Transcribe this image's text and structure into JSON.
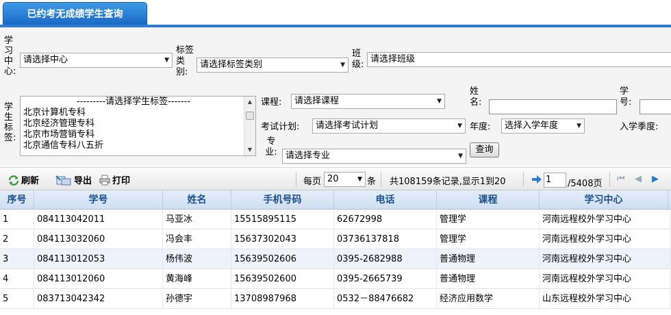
{
  "tab": {
    "title": "已约考无成绩学生查询"
  },
  "filters": {
    "center_label": "学习中心:",
    "center_value": "请选择中心",
    "tag_type_label": "标签类别:",
    "tag_type_value": "请选择标签类别",
    "class_label": "班级:",
    "class_value": "请选择班级",
    "student_tag_label": "学生标签:",
    "student_tag_options": [
      "---------请选择学生标签-------",
      "北京计算机专科",
      "北京经济管理专科",
      "北京市场营销专科",
      "北京通信专科八五折"
    ],
    "course_label": "课程:",
    "course_value": "请选择课程",
    "name_label": "姓名:",
    "student_no_label": "学号:",
    "exam_plan_label": "考试计划:",
    "exam_plan_value": "请选择考试计划",
    "year_label": "年度:",
    "year_value": "选择入学年度",
    "season_label": "入学季度:",
    "major_label": "专业:",
    "major_value": "请选择专业",
    "query_button": "查询"
  },
  "toolbar": {
    "refresh": "刷新",
    "export": "导出",
    "print": "打印",
    "per_page_label": "每页",
    "per_page_value": "20",
    "per_page_unit": "条",
    "summary": "共108159条记录,显示1到20",
    "page_input": "1",
    "page_total": "/5408页"
  },
  "table": {
    "columns": [
      "序号",
      "学号",
      "姓名",
      "手机号码",
      "电话",
      "课程",
      "学习中心"
    ],
    "rows": [
      [
        "1",
        "084113042011",
        "马亚冰",
        "15515895115",
        "62672998",
        "管理学",
        "河南远程校外学习中心"
      ],
      [
        "2",
        "084113032060",
        "冯会丰",
        "15637302043",
        "03736137818",
        "管理学",
        "河南远程校外学习中心"
      ],
      [
        "3",
        "084113012053",
        "杨伟波",
        "15639502606",
        "0395-2682988",
        "普通物理",
        "河南远程校外学习中心"
      ],
      [
        "4",
        "084113012060",
        "黄海峰",
        "15639502600",
        "0395-2665739",
        "普通物理",
        "河南远程校外学习中心"
      ],
      [
        "5",
        "083713042342",
        "孙德宇",
        "13708987968",
        "0532－88476682",
        "经济应用数学",
        "山东远程校外学习中心"
      ]
    ]
  },
  "colors": {
    "tab_blue": "#2f7bd0",
    "header_text": "#1b4f8c",
    "row_alt": "#eef3fb"
  }
}
